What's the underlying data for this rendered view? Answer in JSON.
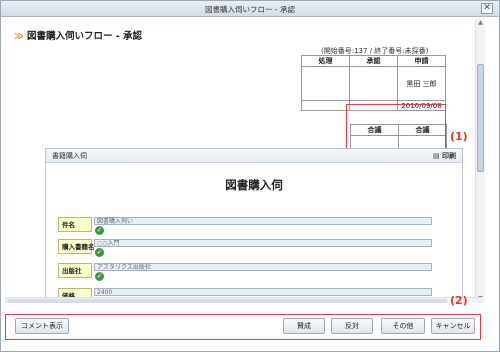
{
  "window": {
    "title": "図書購入伺いフロー - 承認",
    "close_glyph": "✕"
  },
  "page": {
    "heading_mark": "≫",
    "heading": "図書購入伺いフロー - 承認",
    "number_info": "(開始番号:137 / 終了番号:未採番)"
  },
  "approval_table": {
    "headers": [
      "処理",
      "承認",
      "申請"
    ],
    "applicant": "黒田 三郎",
    "date": "2010/09/08"
  },
  "council_table": {
    "headers": [
      "合議",
      "合議"
    ]
  },
  "callouts": {
    "label1": "(1)",
    "label2": "(2)"
  },
  "form": {
    "panel_title": "書籍購入伺",
    "print_label": "印刷",
    "print_icon": "printer-icon",
    "title": "図書購入伺",
    "fields": [
      {
        "label": "件名",
        "value": "図書購入伺い"
      },
      {
        "label": "購入書籍名",
        "value": "○○入門"
      },
      {
        "label": "出版社",
        "value": "アスタリクス出版社"
      },
      {
        "label": "価格",
        "value": "2400"
      }
    ],
    "check_glyph": "✓"
  },
  "buttons": {
    "comment": "コメント表示",
    "agree": "賛成",
    "oppose": "反対",
    "other": "その他",
    "cancel": "キャンセル"
  },
  "colors": {
    "callout_red": "#e24040",
    "field_label_bg": "#ffffcc",
    "check_green": "#3b9a3a"
  }
}
